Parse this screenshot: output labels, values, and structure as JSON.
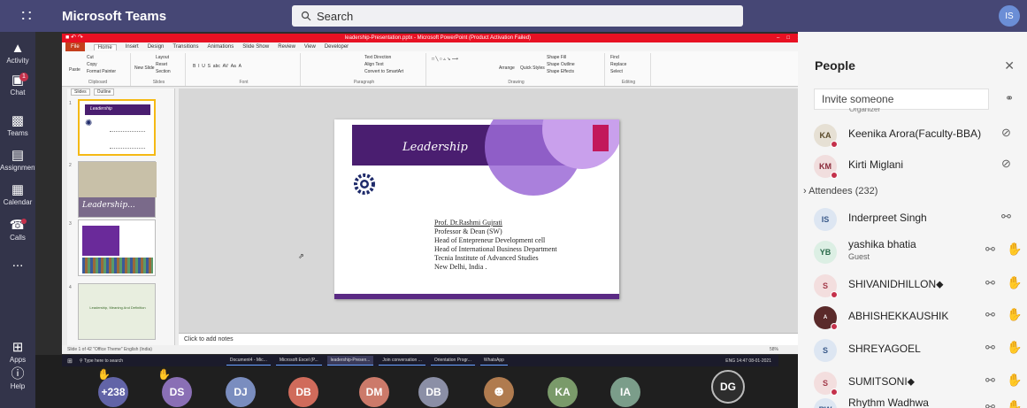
{
  "app": {
    "title": "Microsoft Teams",
    "search_placeholder": "Search",
    "user_initials": "IS"
  },
  "rail": [
    {
      "label": "Activity",
      "icon": "bell-icon"
    },
    {
      "label": "Chat",
      "icon": "chat-icon",
      "badge": "1"
    },
    {
      "label": "Teams",
      "icon": "teams-icon"
    },
    {
      "label": "Assignments",
      "icon": "assignments-icon"
    },
    {
      "label": "Calendar",
      "icon": "calendar-icon"
    },
    {
      "label": "Calls",
      "icon": "phone-icon"
    },
    {
      "label": "...",
      "icon": "more-icon"
    },
    {
      "label": "Apps",
      "icon": "apps-icon"
    },
    {
      "label": "Help",
      "icon": "help-icon"
    }
  ],
  "powerpoint": {
    "title": "leadership-Presentation.pptx - Microsoft PowerPoint (Product Activation Failed)",
    "tabs": [
      "File",
      "Home",
      "Insert",
      "Design",
      "Transitions",
      "Animations",
      "Slide Show",
      "Review",
      "View",
      "Developer"
    ],
    "ribbon_groups": [
      "Clipboard",
      "Slides",
      "Font",
      "Paragraph",
      "Drawing",
      "Editing"
    ],
    "ribbon_items": {
      "cut": "Cut",
      "copy": "Copy",
      "paste": "Paste",
      "format_painter": "Format Painter",
      "new_slide": "New Slide",
      "layout": "Layout",
      "reset": "Reset",
      "section": "Section",
      "text_direction": "Text Direction",
      "align_text": "Align Text",
      "smartart": "Convert to SmartArt",
      "arrange": "Arrange",
      "quick_styles": "Quick Styles",
      "shape_fill": "Shape Fill",
      "shape_outline": "Shape Outline",
      "shape_effects": "Shape Effects",
      "find": "Find",
      "replace": "Replace",
      "select": "Select"
    },
    "pane_tabs": [
      "Slides",
      "Outline"
    ],
    "thumbnails": [
      {
        "num": "1",
        "title": "Leadership"
      },
      {
        "num": "2",
        "title": "Leadership..."
      },
      {
        "num": "3",
        "title": ""
      },
      {
        "num": "4",
        "title": "Leadership, Meaning And Definition"
      }
    ],
    "slide": {
      "title": "Leadership",
      "lines": [
        "Prof. Dr.Rashmi Gujrati",
        "Professor & Dean (SW)",
        "Head of Entepreneur Development cell",
        "Head of International Business Department",
        "Tecnia Institute of Advanced Studies",
        "New Delhi, India ."
      ]
    },
    "notes_placeholder": "Click to add notes",
    "status": "Slide 1 of 42   \"Office Theme\"   English (India)",
    "zoom": "58%"
  },
  "taskbar": {
    "search": "Type here to search",
    "items": [
      "Document4 - Mic...",
      "Microsoft Excel (P...",
      "leadership-Presen...",
      "Join conversation ...",
      "Orientation Progr...",
      "WhatsApp"
    ],
    "time": "14:47",
    "date": "08-01-2021",
    "lang": "ENG"
  },
  "call_bar": {
    "count": "+238",
    "participants": [
      {
        "initials": "DS",
        "color": "#8a6fb5",
        "raised": true
      },
      {
        "initials": "DJ",
        "color": "#7a8dbf",
        "raised": false
      },
      {
        "initials": "DB",
        "color": "#d06b5b",
        "raised": false
      },
      {
        "initials": "DM",
        "color": "#cc7a6a",
        "raised": false
      },
      {
        "initials": "DB",
        "color": "#8b8fa6",
        "raised": false
      },
      {
        "initials": "",
        "color": "#b07b4f",
        "raised": false
      },
      {
        "initials": "KA",
        "color": "#7a9a6a",
        "raised": false
      },
      {
        "initials": "IA",
        "color": "#7b9d8a",
        "raised": false
      }
    ],
    "self": "DG"
  },
  "people": {
    "title": "People",
    "invite_placeholder": "Invite someone",
    "peek_text": "Organizer",
    "attendees_header": "Attendees (232)",
    "list": [
      {
        "initials": "KA",
        "name": "Keenika Arora(Faculty-BBA)",
        "bg": "#e6e0d4",
        "fg": "#5a4a2a",
        "mic": "off",
        "hand": false,
        "status": true
      },
      {
        "initials": "KM",
        "name": "Kirti Miglani",
        "bg": "#f1dede",
        "fg": "#8a2a3a",
        "mic": "off",
        "hand": false,
        "status": true
      },
      {
        "initials": "IS",
        "name": "Inderpreet Singh",
        "bg": "#dde6f2",
        "fg": "#3a5a8a",
        "mic": "on",
        "hand": false,
        "status": false
      },
      {
        "initials": "YB",
        "name": "yashika bhatia",
        "sub": "Guest",
        "bg": "#dcefe4",
        "fg": "#2a6a4a",
        "mic": "on",
        "hand": true,
        "status": false
      },
      {
        "initials": "S",
        "name": "SHIVANIDHILLON⬥",
        "bg": "#f3dede",
        "fg": "#a33a4a",
        "mic": "on",
        "hand": true,
        "status": true
      },
      {
        "initials": "A",
        "name": "ABHISHEKKAUSHIK",
        "bg": "#5a2a2a",
        "fg": "#ffffff",
        "mic": "on",
        "hand": true,
        "status": true
      },
      {
        "initials": "S",
        "name": "SHREYAGOEL",
        "bg": "#dde6f2",
        "fg": "#3a5a8a",
        "mic": "on",
        "hand": true,
        "status": false
      },
      {
        "initials": "S",
        "name": "SUMITSONI⬥",
        "bg": "#f3dede",
        "fg": "#a33a4a",
        "mic": "on",
        "hand": true,
        "status": true
      },
      {
        "initials": "RW",
        "name": "Rhythm Wadhwa",
        "bg": "#dde6f2",
        "fg": "#3a5a8a",
        "mic": "on",
        "hand": true,
        "status": false
      }
    ]
  }
}
